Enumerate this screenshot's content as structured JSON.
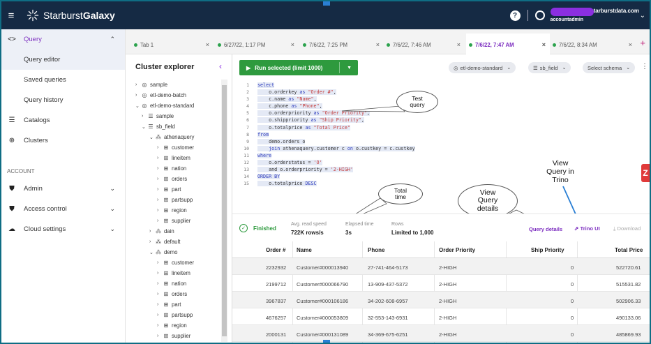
{
  "app": {
    "brand_light": "Starburst",
    "brand_bold": "Galaxy",
    "user_domain": "tarburstdata.com",
    "user_role": "accountadmin",
    "help_glyph": "?",
    "menu_icon": "hamburger-icon"
  },
  "nav": {
    "query": "Query",
    "query_editor": "Query editor",
    "saved_queries": "Saved queries",
    "query_history": "Query history",
    "catalogs": "Catalogs",
    "clusters": "Clusters",
    "account_section": "ACCOUNT",
    "admin": "Admin",
    "access_control": "Access control",
    "cloud_settings": "Cloud settings"
  },
  "tabs": [
    {
      "label": "Tab 1"
    },
    {
      "label": "6/27/22, 1:17 PM"
    },
    {
      "label": "7/6/22, 7:25 PM"
    },
    {
      "label": "7/6/22, 7:46 AM"
    },
    {
      "label": "7/6/22, 7:47 AM"
    },
    {
      "label": "7/6/22, 8:34 AM"
    }
  ],
  "explorer": {
    "title": "Cluster explorer",
    "tree": [
      {
        "label": "sample"
      },
      {
        "label": "etl-demo-batch"
      },
      {
        "label": "etl-demo-standard"
      },
      {
        "label": "sample"
      },
      {
        "label": "sb_field"
      },
      {
        "label": "athenaquery"
      },
      {
        "label": "customer"
      },
      {
        "label": "lineitem"
      },
      {
        "label": "nation"
      },
      {
        "label": "orders"
      },
      {
        "label": "part"
      },
      {
        "label": "partsupp"
      },
      {
        "label": "region"
      },
      {
        "label": "supplier"
      },
      {
        "label": "dain"
      },
      {
        "label": "default"
      },
      {
        "label": "demo"
      },
      {
        "label": "customer"
      },
      {
        "label": "lineitem"
      },
      {
        "label": "nation"
      },
      {
        "label": "orders"
      },
      {
        "label": "part"
      },
      {
        "label": "partsupp"
      },
      {
        "label": "region"
      },
      {
        "label": "supplier"
      }
    ]
  },
  "toolbar": {
    "run_label": "Run selected (limit 1000)",
    "cluster_pill": "etl-demo-standard",
    "catalog_pill": "sb_field",
    "schema_pill": "Select schema"
  },
  "editor": {
    "line_numbers": [
      "1",
      "2",
      "3",
      "4",
      "5",
      "6",
      "7",
      "8",
      "9",
      "10",
      "11",
      "12",
      "13",
      "14",
      "15"
    ]
  },
  "callouts": {
    "test_query": "Test query",
    "total_time": "Total time",
    "view_query_details": "View Query details",
    "view_query_trino": "View Query in Trino"
  },
  "status": {
    "state": "Finished",
    "avg_label": "Avg. read speed",
    "avg_value": "722K rows/s",
    "elapsed_label": "Elapsed time",
    "elapsed_value": "3s",
    "rows_label": "Rows",
    "rows_value": "Limited to 1,000",
    "query_details": "Query details",
    "trino_ui": "Trino UI",
    "download": "Download"
  },
  "results": {
    "columns": [
      "Order #",
      "Name",
      "Phone",
      "Order Priority",
      "Ship Priority",
      "Total Price"
    ],
    "rows": [
      [
        "2232932",
        "Customer#000013940",
        "27-741-464-5173",
        "2-HIGH",
        "0",
        "522720.61"
      ],
      [
        "2199712",
        "Customer#000066790",
        "13-909-437-5372",
        "2-HIGH",
        "0",
        "515531.82"
      ],
      [
        "3967837",
        "Customer#000106186",
        "34-202-608-6957",
        "2-HIGH",
        "0",
        "502906.33"
      ],
      [
        "4676257",
        "Customer#000053809",
        "32-553-143-6931",
        "2-HIGH",
        "0",
        "490133.06"
      ],
      [
        "2000131",
        "Customer#000131089",
        "34-369-675-6251",
        "2-HIGH",
        "0",
        "485869.93"
      ]
    ]
  },
  "colors": {
    "topbar": "#152a44",
    "accent": "#7b2cbf",
    "run": "#2e9a3e"
  }
}
